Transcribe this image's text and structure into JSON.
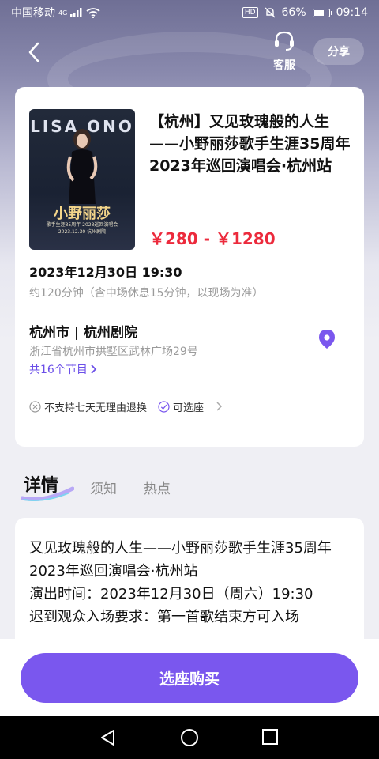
{
  "status_bar": {
    "carrier": "中国移动",
    "network": "4G",
    "battery_percent": "66%",
    "time": "09:14"
  },
  "header": {
    "service_label": "客服",
    "share_label": "分享"
  },
  "show": {
    "poster": {
      "brand": "LISA ONO",
      "title": "小野丽莎",
      "subtitle": "歌手生涯35周年 2023巡回演唱会 2023.12.30 杭州剧院"
    },
    "title": "【杭州】又见玫瑰般的人生——小野丽莎歌手生涯35周年 2023年巡回演唱会·杭州站",
    "price": "￥280 - ￥1280",
    "datetime": "2023年12月30日 19:30",
    "duration": "约120分钟（含中场休息15分钟，以现场为准）",
    "venue": "杭州市 | 杭州剧院",
    "address": "浙江省杭州市拱墅区武林广场29号",
    "sessions": "共16个节目",
    "policies": [
      {
        "label": "不支持七天无理由退换",
        "icon": "x-circle-icon"
      },
      {
        "label": "可选座",
        "icon": "check-circle-icon"
      }
    ]
  },
  "tabs": {
    "details": "详情",
    "notice": "须知",
    "hot": "热点"
  },
  "details": {
    "lines": [
      "又见玫瑰般的人生——小野丽莎歌手生涯35周年",
      "2023年巡回演唱会·杭州站",
      "演出时间：2023年12月30日（周六）19:30",
      "迟到观众入场要求：第一首歌结束方可入场"
    ]
  },
  "bottom": {
    "buy_label": "选座购买"
  },
  "colors": {
    "accent": "#7a57ee",
    "price": "#ec2a3c",
    "link": "#6b4fe8"
  }
}
